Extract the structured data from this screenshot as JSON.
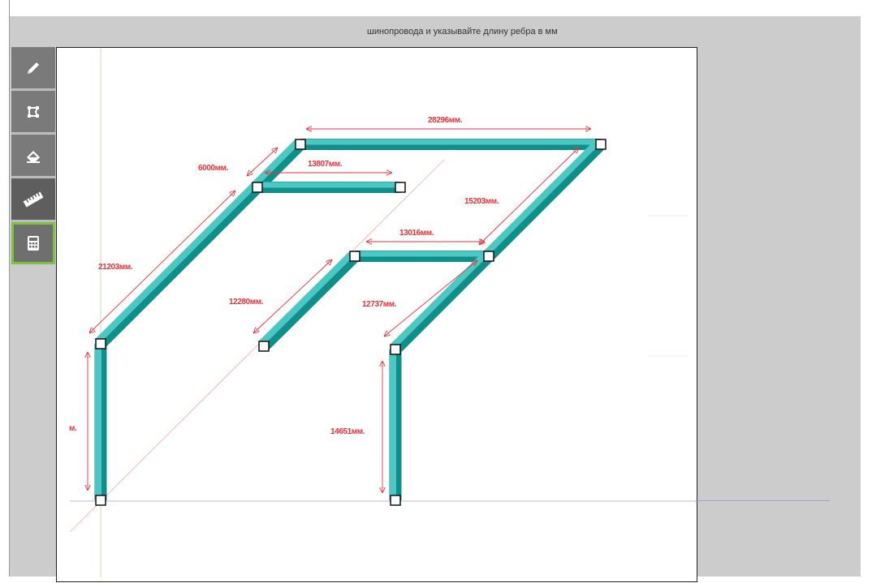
{
  "header": {
    "instruction": "шинопровода и указывайте длину ребра в мм"
  },
  "toolbar": {
    "tools": [
      {
        "icon": "pencil-icon",
        "name": "draw"
      },
      {
        "icon": "select-shape-icon",
        "name": "select"
      },
      {
        "icon": "eraser-icon",
        "name": "erase"
      },
      {
        "icon": "ruler-icon",
        "name": "measure",
        "active": true
      },
      {
        "icon": "calculator-icon",
        "name": "calculate",
        "highlighted": true
      }
    ]
  },
  "colors": {
    "busbar": "#4cc7c3",
    "busbar_shadow": "#0f8e8a",
    "dimension": "#e8303a",
    "workspace_bg": "#cccccc",
    "accent_green": "#7cc242"
  },
  "drawing": {
    "dimensions": {
      "d28296": "28296мм.",
      "d6000": "6000мм.",
      "d13807": "13807мм.",
      "d15203": "15203мм.",
      "d21203": "21203мм.",
      "d13016": "13016мм.",
      "d12280": "12280мм.",
      "d12737": "12737мм.",
      "d14651": "14651мм.",
      "dpartial": "м."
    }
  }
}
